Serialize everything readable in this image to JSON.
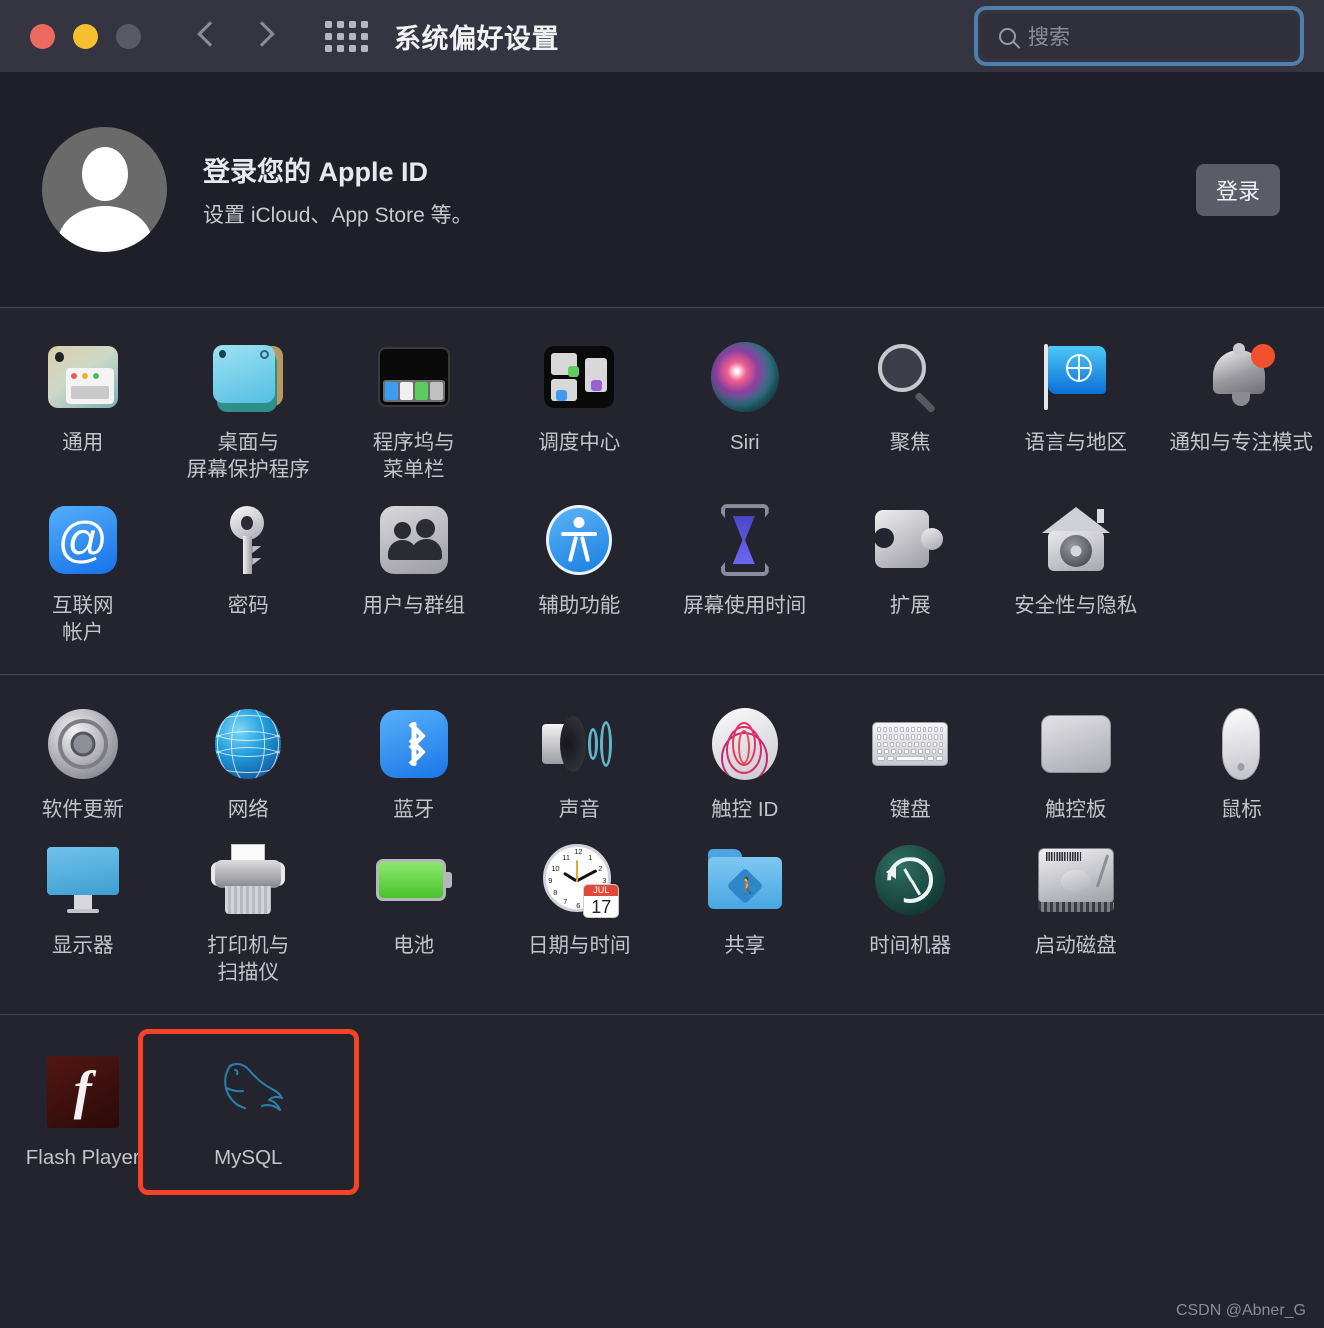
{
  "window": {
    "title": "系统偏好设置",
    "traffic_lights": [
      "close",
      "minimize",
      "zoom"
    ],
    "nav_back": "back-chevron",
    "nav_forward": "forward-chevron",
    "grid_button": "show-all-grid"
  },
  "search": {
    "placeholder": "搜索",
    "value": "",
    "focused": true,
    "focus_color": "#4e7fae"
  },
  "apple_id": {
    "title": "登录您的 Apple ID",
    "subtitle": "设置 iCloud、App Store 等。",
    "sign_in_label": "登录"
  },
  "sections": [
    {
      "name": "personal",
      "rows": [
        [
          {
            "id": "general",
            "label": "通用",
            "icon": "general-icon"
          },
          {
            "id": "desktop",
            "label": "桌面与\n屏幕保护程序",
            "icon": "desktop-screensaver-icon"
          },
          {
            "id": "dock",
            "label": "程序坞与\n菜单栏",
            "icon": "dock-menubar-icon"
          },
          {
            "id": "mission",
            "label": "调度中心",
            "icon": "mission-control-icon"
          },
          {
            "id": "siri",
            "label": "Siri",
            "icon": "siri-icon"
          },
          {
            "id": "spotlight",
            "label": "聚焦",
            "icon": "spotlight-icon"
          },
          {
            "id": "language",
            "label": "语言与地区",
            "icon": "language-region-icon"
          },
          {
            "id": "notifications",
            "label": "通知与专注模式",
            "icon": "notifications-icon",
            "badge": true
          }
        ],
        [
          {
            "id": "internet",
            "label": "互联网\n帐户",
            "icon": "internet-accounts-icon"
          },
          {
            "id": "passwords",
            "label": "密码",
            "icon": "passwords-key-icon"
          },
          {
            "id": "users",
            "label": "用户与群组",
            "icon": "users-groups-icon"
          },
          {
            "id": "accessibility",
            "label": "辅助功能",
            "icon": "accessibility-icon"
          },
          {
            "id": "screentime",
            "label": "屏幕使用时间",
            "icon": "screen-time-icon"
          },
          {
            "id": "extensions",
            "label": "扩展",
            "icon": "extensions-puzzle-icon"
          },
          {
            "id": "security",
            "label": "安全性与隐私",
            "icon": "security-privacy-icon"
          },
          {
            "id": "empty1",
            "label": "",
            "icon": "none"
          }
        ]
      ]
    },
    {
      "name": "hardware",
      "rows": [
        [
          {
            "id": "softwareupdate",
            "label": "软件更新",
            "icon": "software-update-icon"
          },
          {
            "id": "network",
            "label": "网络",
            "icon": "network-globe-icon"
          },
          {
            "id": "bluetooth",
            "label": "蓝牙",
            "icon": "bluetooth-icon"
          },
          {
            "id": "sound",
            "label": "声音",
            "icon": "sound-speaker-icon"
          },
          {
            "id": "touchid",
            "label": "触控 ID",
            "icon": "touch-id-icon"
          },
          {
            "id": "keyboard",
            "label": "键盘",
            "icon": "keyboard-icon"
          },
          {
            "id": "trackpad",
            "label": "触控板",
            "icon": "trackpad-icon"
          },
          {
            "id": "mouse",
            "label": "鼠标",
            "icon": "mouse-icon"
          }
        ],
        [
          {
            "id": "displays",
            "label": "显示器",
            "icon": "displays-icon"
          },
          {
            "id": "printers",
            "label": "打印机与\n扫描仪",
            "icon": "printers-scanners-icon"
          },
          {
            "id": "battery",
            "label": "电池",
            "icon": "battery-icon"
          },
          {
            "id": "datetime",
            "label": "日期与时间",
            "icon": "date-time-icon",
            "clock_month": "JUL",
            "clock_day": "17"
          },
          {
            "id": "sharing",
            "label": "共享",
            "icon": "sharing-folder-icon"
          },
          {
            "id": "timemachine",
            "label": "时间机器",
            "icon": "time-machine-icon"
          },
          {
            "id": "startupdisk",
            "label": "启动磁盘",
            "icon": "startup-disk-icon"
          },
          {
            "id": "empty2",
            "label": "",
            "icon": "none"
          }
        ]
      ]
    },
    {
      "name": "third-party",
      "rows": [
        [
          {
            "id": "flashplayer",
            "label": "Flash Player",
            "icon": "flash-player-icon"
          },
          {
            "id": "mysql",
            "label": "MySQL",
            "icon": "mysql-dolphin-icon",
            "highlighted": true,
            "highlight_color": "#f64327"
          },
          {
            "id": "empty3",
            "label": "",
            "icon": "none"
          },
          {
            "id": "empty4",
            "label": "",
            "icon": "none"
          },
          {
            "id": "empty5",
            "label": "",
            "icon": "none"
          },
          {
            "id": "empty6",
            "label": "",
            "icon": "none"
          },
          {
            "id": "empty7",
            "label": "",
            "icon": "none"
          },
          {
            "id": "empty8",
            "label": "",
            "icon": "none"
          }
        ]
      ]
    }
  ],
  "watermark": "CSDN @Abner_G"
}
